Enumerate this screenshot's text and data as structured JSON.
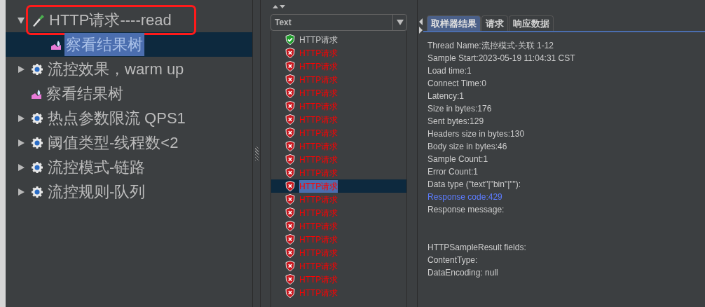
{
  "tree": [
    {
      "label": "HTTP请求----read",
      "kind": "sampler",
      "expanded": true,
      "selected": false,
      "annotated": true,
      "children": [
        {
          "label": "察看结果树",
          "kind": "listener",
          "selected": true
        }
      ]
    },
    {
      "label": "流控效果，warm up",
      "kind": "group",
      "expanded": false,
      "selected": false
    },
    {
      "label": "察看结果树",
      "kind": "listener",
      "selected": false
    },
    {
      "label": "热点参数限流 QPS1",
      "kind": "group",
      "expanded": false,
      "selected": false
    },
    {
      "label": "阈值类型-线程数<2",
      "kind": "group",
      "expanded": false,
      "selected": false
    },
    {
      "label": "流控模式-链路",
      "kind": "group",
      "expanded": false,
      "selected": false
    },
    {
      "label": "流控规则-队列",
      "kind": "group",
      "expanded": false,
      "selected": false
    }
  ],
  "renderer": {
    "value": "Text"
  },
  "results": [
    {
      "label": "HTTP请求",
      "success": true,
      "selected": false
    },
    {
      "label": "HTTP请求",
      "success": false,
      "selected": false
    },
    {
      "label": "HTTP请求",
      "success": false,
      "selected": false
    },
    {
      "label": "HTTP请求",
      "success": false,
      "selected": false
    },
    {
      "label": "HTTP请求",
      "success": false,
      "selected": false
    },
    {
      "label": "HTTP请求",
      "success": false,
      "selected": false
    },
    {
      "label": "HTTP请求",
      "success": false,
      "selected": false
    },
    {
      "label": "HTTP请求",
      "success": false,
      "selected": false
    },
    {
      "label": "HTTP请求",
      "success": false,
      "selected": false
    },
    {
      "label": "HTTP请求",
      "success": false,
      "selected": false
    },
    {
      "label": "HTTP请求",
      "success": false,
      "selected": false
    },
    {
      "label": "HTTP请求",
      "success": false,
      "selected": true
    },
    {
      "label": "HTTP请求",
      "success": false,
      "selected": false
    },
    {
      "label": "HTTP请求",
      "success": false,
      "selected": false
    },
    {
      "label": "HTTP请求",
      "success": false,
      "selected": false
    },
    {
      "label": "HTTP请求",
      "success": false,
      "selected": false
    },
    {
      "label": "HTTP请求",
      "success": false,
      "selected": false
    },
    {
      "label": "HTTP请求",
      "success": false,
      "selected": false
    },
    {
      "label": "HTTP请求",
      "success": false,
      "selected": false
    },
    {
      "label": "HTTP请求",
      "success": false,
      "selected": false
    }
  ],
  "tabs": [
    {
      "label": "取样器结果",
      "selected": true
    },
    {
      "label": "请求",
      "selected": false
    },
    {
      "label": "响应数据",
      "selected": false
    }
  ],
  "details": [
    {
      "text": "Thread Name:流控模式-关联 1-12",
      "kind": "normal"
    },
    {
      "text": "Sample Start:2023-05-19 11:04:31 CST",
      "kind": "normal"
    },
    {
      "text": "Load time:1",
      "kind": "normal"
    },
    {
      "text": "Connect Time:0",
      "kind": "normal"
    },
    {
      "text": "Latency:1",
      "kind": "normal"
    },
    {
      "text": "Size in bytes:176",
      "kind": "normal"
    },
    {
      "text": "Sent bytes:129",
      "kind": "normal"
    },
    {
      "text": "Headers size in bytes:130",
      "kind": "normal"
    },
    {
      "text": "Body size in bytes:46",
      "kind": "normal"
    },
    {
      "text": "Sample Count:1",
      "kind": "normal"
    },
    {
      "text": "Error Count:1",
      "kind": "normal"
    },
    {
      "text": "Data type (\"text\"|\"bin\"|\"\"):",
      "kind": "normal"
    },
    {
      "text": "Response code:429",
      "kind": "error"
    },
    {
      "text": "Response message:",
      "kind": "normal"
    },
    {
      "kind": "blank"
    },
    {
      "kind": "blank"
    },
    {
      "text": "HTTPSampleResult fields:",
      "kind": "normal"
    },
    {
      "text": "ContentType:",
      "kind": "normal"
    },
    {
      "text": "DataEncoding: null",
      "kind": "normal"
    }
  ]
}
